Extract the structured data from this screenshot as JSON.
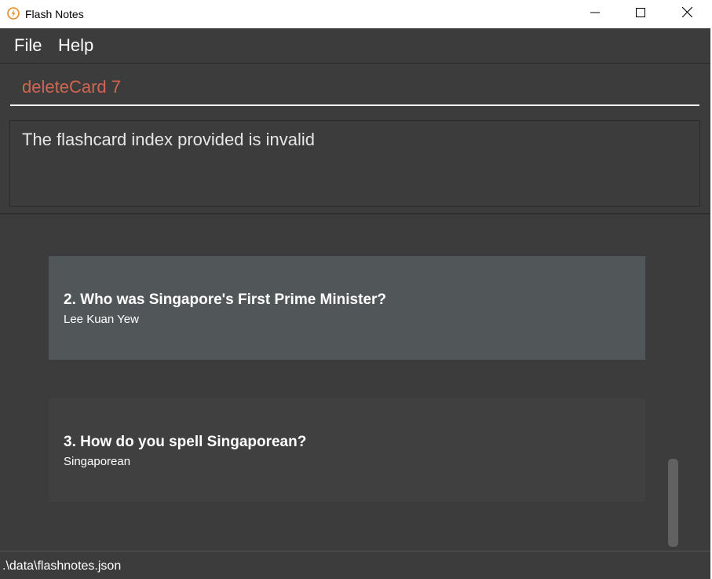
{
  "window": {
    "title": "Flash Notes",
    "icon": "flash-notes-logo-icon",
    "controls": [
      "minimize-icon",
      "maximize-icon",
      "close-icon"
    ]
  },
  "menu": {
    "file_label": "File",
    "help_label": "Help"
  },
  "command": {
    "value": "deleteCard 7",
    "text_color": "#d06651"
  },
  "result": {
    "message": "The flashcard index provided is invalid"
  },
  "flashcards": [
    {
      "index": "2.",
      "question": "Who was Singapore's First Prime Minister?",
      "answer": "Lee Kuan Yew",
      "selected": true
    },
    {
      "index": "3.",
      "question": "How do you spell Singaporean?",
      "answer": "Singaporean",
      "selected": false
    }
  ],
  "status": {
    "file_path": ".\\data\\flashnotes.json"
  },
  "colors": {
    "background": "#3c3c3c",
    "selected_card": "#515658",
    "card": "#404040",
    "accent": "#d06651"
  }
}
